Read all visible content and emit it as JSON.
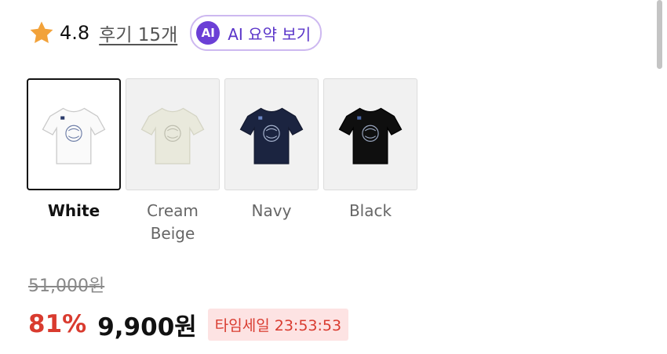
{
  "rating": {
    "value": "4.8",
    "review_link": "후기 15개",
    "star_color": "#f2a23a"
  },
  "ai_summary": {
    "badge": "AI",
    "label": "AI 요약 보기",
    "accent": "#6b3fd6"
  },
  "color_options": [
    {
      "label": "White",
      "selected": true,
      "shirt_color": "#fafafa"
    },
    {
      "label": "Cream Beige",
      "selected": false,
      "shirt_color": "#e9e9dc"
    },
    {
      "label": "Navy",
      "selected": false,
      "shirt_color": "#1b2440"
    },
    {
      "label": "Black",
      "selected": false,
      "shirt_color": "#0f0f0f"
    }
  ],
  "price": {
    "original": "51,000원",
    "discount": "81%",
    "sale": "9,900원",
    "timesale": "타임세일 23:53:53",
    "discount_color": "#d93b2f"
  }
}
